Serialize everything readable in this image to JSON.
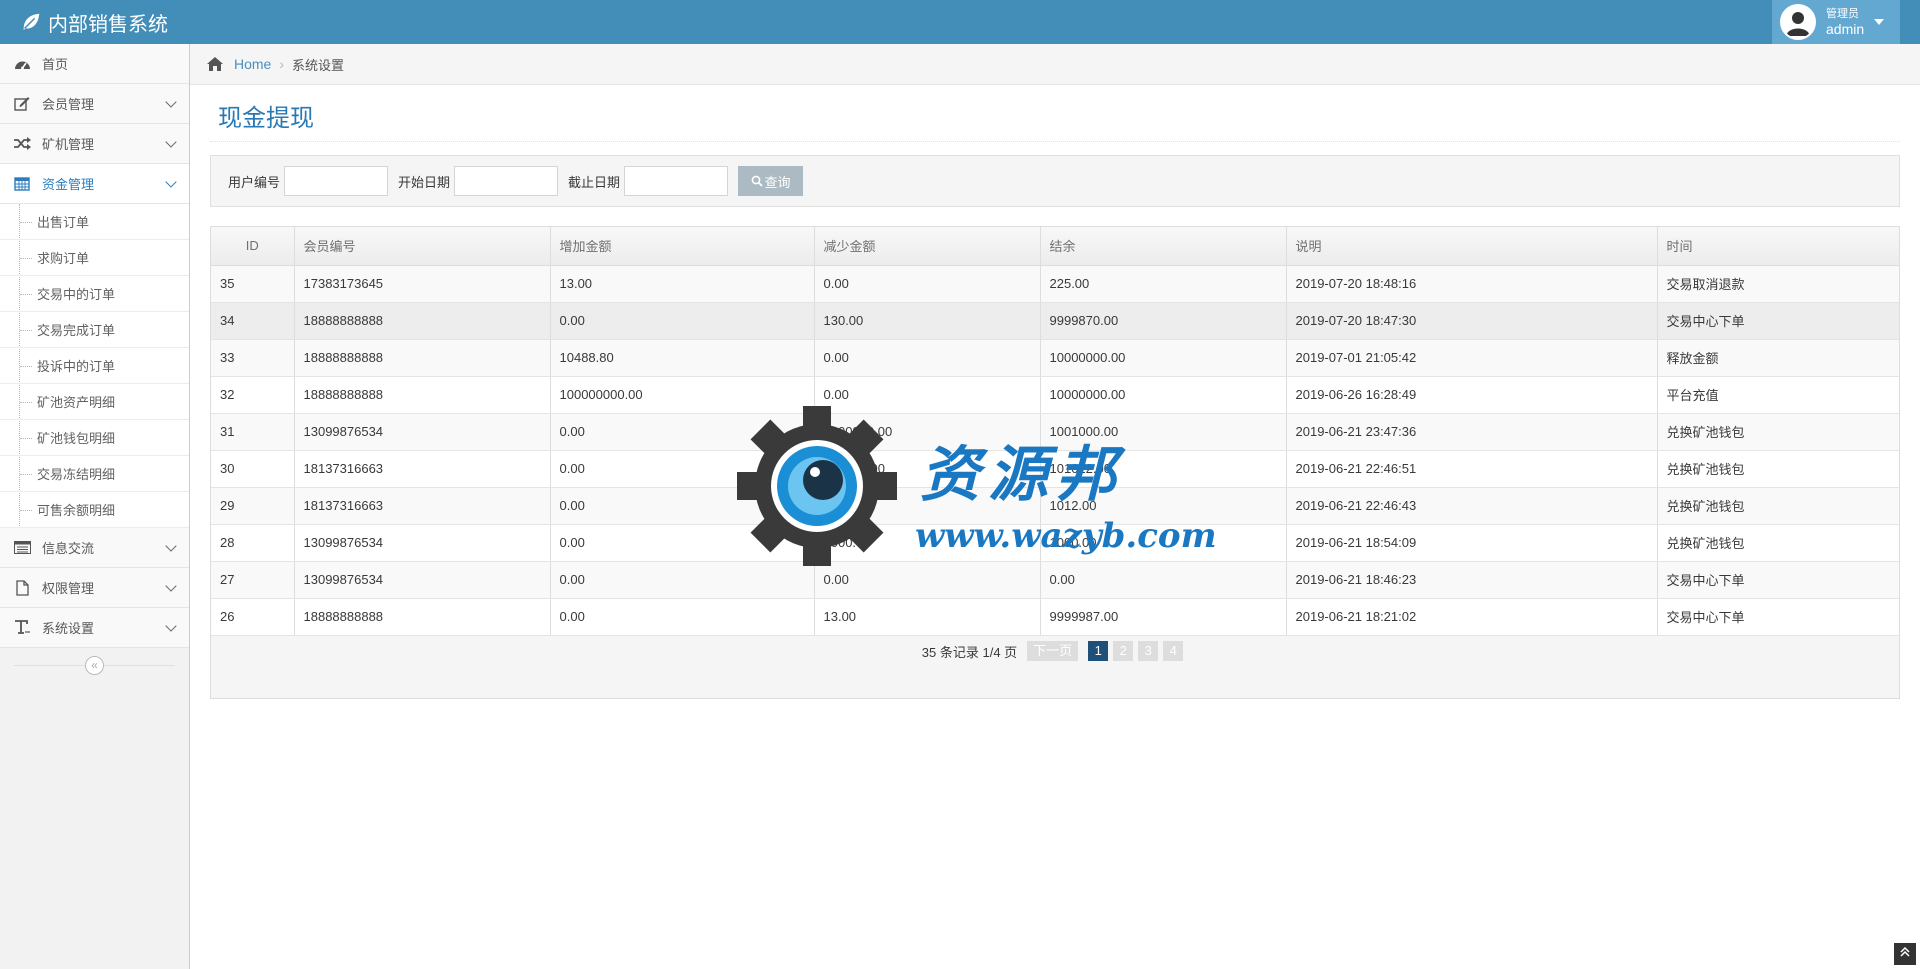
{
  "app": {
    "title": "内部销售系统"
  },
  "user": {
    "role": "管理员",
    "name": "admin"
  },
  "sidebar": {
    "items": [
      {
        "label": "首页",
        "icon": "dashboard-icon"
      },
      {
        "label": "会员管理",
        "icon": "edit-icon"
      },
      {
        "label": "矿机管理",
        "icon": "shuffle-icon"
      },
      {
        "label": "资金管理",
        "icon": "calendar-icon",
        "active": true
      },
      {
        "label": "信息交流",
        "icon": "list-icon"
      },
      {
        "label": "权限管理",
        "icon": "file-icon"
      },
      {
        "label": "系统设置",
        "icon": "text-icon"
      }
    ],
    "submenu": [
      "出售订单",
      "求购订单",
      "交易中的订单",
      "交易完成订单",
      "投诉中的订单",
      "矿池资产明细",
      "矿池钱包明细",
      "交易冻结明细",
      "可售余额明细"
    ]
  },
  "breadcrumb": {
    "home": "Home",
    "current": "系统设置"
  },
  "page": {
    "title": "现金提现"
  },
  "filters": {
    "user_no_label": "用户编号",
    "start_date_label": "开始日期",
    "end_date_label": "截止日期",
    "user_no_value": "",
    "start_date_value": "",
    "end_date_value": "",
    "search_label": "查询"
  },
  "table": {
    "columns": [
      "ID",
      "会员编号",
      "增加金额",
      "减少金额",
      "结余",
      "说明",
      "时间"
    ],
    "rows": [
      [
        "35",
        "17383173645",
        "13.00",
        "0.00",
        "225.00",
        "2019-07-20 18:48:16",
        "交易取消退款"
      ],
      [
        "34",
        "18888888888",
        "0.00",
        "130.00",
        "9999870.00",
        "2019-07-20 18:47:30",
        "交易中心下单"
      ],
      [
        "33",
        "18888888888",
        "10488.80",
        "0.00",
        "10000000.00",
        "2019-07-01 21:05:42",
        "释放金额"
      ],
      [
        "32",
        "18888888888",
        "100000000.00",
        "0.00",
        "10000000.00",
        "2019-06-26 16:28:49",
        "平台充值"
      ],
      [
        "31",
        "13099876534",
        "0.00",
        "1000000.00",
        "1001000.00",
        "2019-06-21 23:47:36",
        "兑换矿池钱包"
      ],
      [
        "30",
        "18137316663",
        "0.00",
        "100000.00",
        "101012.00",
        "2019-06-21 22:46:51",
        "兑换矿池钱包"
      ],
      [
        "29",
        "18137316663",
        "0.00",
        "1000.00",
        "1012.00",
        "2019-06-21 22:46:43",
        "兑换矿池钱包"
      ],
      [
        "28",
        "13099876534",
        "0.00",
        "1000.00",
        "1000.00",
        "2019-06-21 18:54:09",
        "兑换矿池钱包"
      ],
      [
        "27",
        "13099876534",
        "0.00",
        "0.00",
        "0.00",
        "2019-06-21 18:46:23",
        "交易中心下单"
      ],
      [
        "26",
        "18888888888",
        "0.00",
        "13.00",
        "9999987.00",
        "2019-06-21 18:21:02",
        "交易中心下单"
      ]
    ]
  },
  "pager": {
    "summary": "35 条记录 1/4 页",
    "next": "下一页",
    "pages": [
      "1",
      "2",
      "3",
      "4"
    ],
    "current": "1"
  },
  "watermark": {
    "text": "资源邦",
    "url": "www.wazyb.com"
  },
  "colors": {
    "navbar": "#438eb9",
    "accent": "#2679b5",
    "active_page": "#1f5079"
  }
}
